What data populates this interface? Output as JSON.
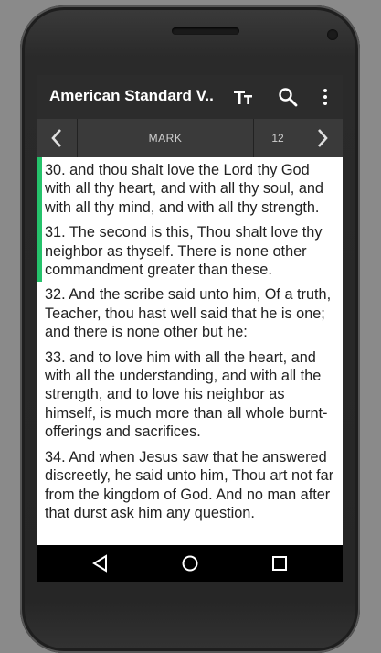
{
  "app": {
    "title": "American Standard V..."
  },
  "toolbar_icons": [
    "text-size-icon",
    "search-icon",
    "overflow-menu-icon"
  ],
  "navigation": {
    "prev": "‹",
    "book": "MARK",
    "chapter": "12",
    "next": "›"
  },
  "verses": [
    {
      "text": "30. and thou shalt love the Lord thy God with all thy heart, and with all thy soul, and with all thy mind, and with all thy strength.",
      "highlighted": true
    },
    {
      "text": "31. The second is this, Thou shalt love thy neighbor as thyself. There is none other commandment greater than these.",
      "highlighted": true
    },
    {
      "text": "32. And the scribe said unto him, Of a truth, Teacher, thou hast well said that he is one; and there is none other but he:",
      "highlighted": false
    },
    {
      "text": "33. and to love him with all the heart, and with all the understanding, and with all the strength, and to love his neighbor as himself, is much more than all whole burnt-offerings and sacrifices.",
      "highlighted": false
    },
    {
      "text": "34. And when Jesus saw that he answered discreetly, he said unto him, Thou art not far from the kingdom of God. And no man after that durst ask him any question.",
      "highlighted": false
    }
  ],
  "colors": {
    "toolbar": "#2c2c2c",
    "nav_bar": "#3a3a3a",
    "highlight": "#25c26b",
    "device_background": "#8a8a8a"
  },
  "system_nav": [
    "back-icon",
    "home-icon",
    "recents-icon"
  ]
}
